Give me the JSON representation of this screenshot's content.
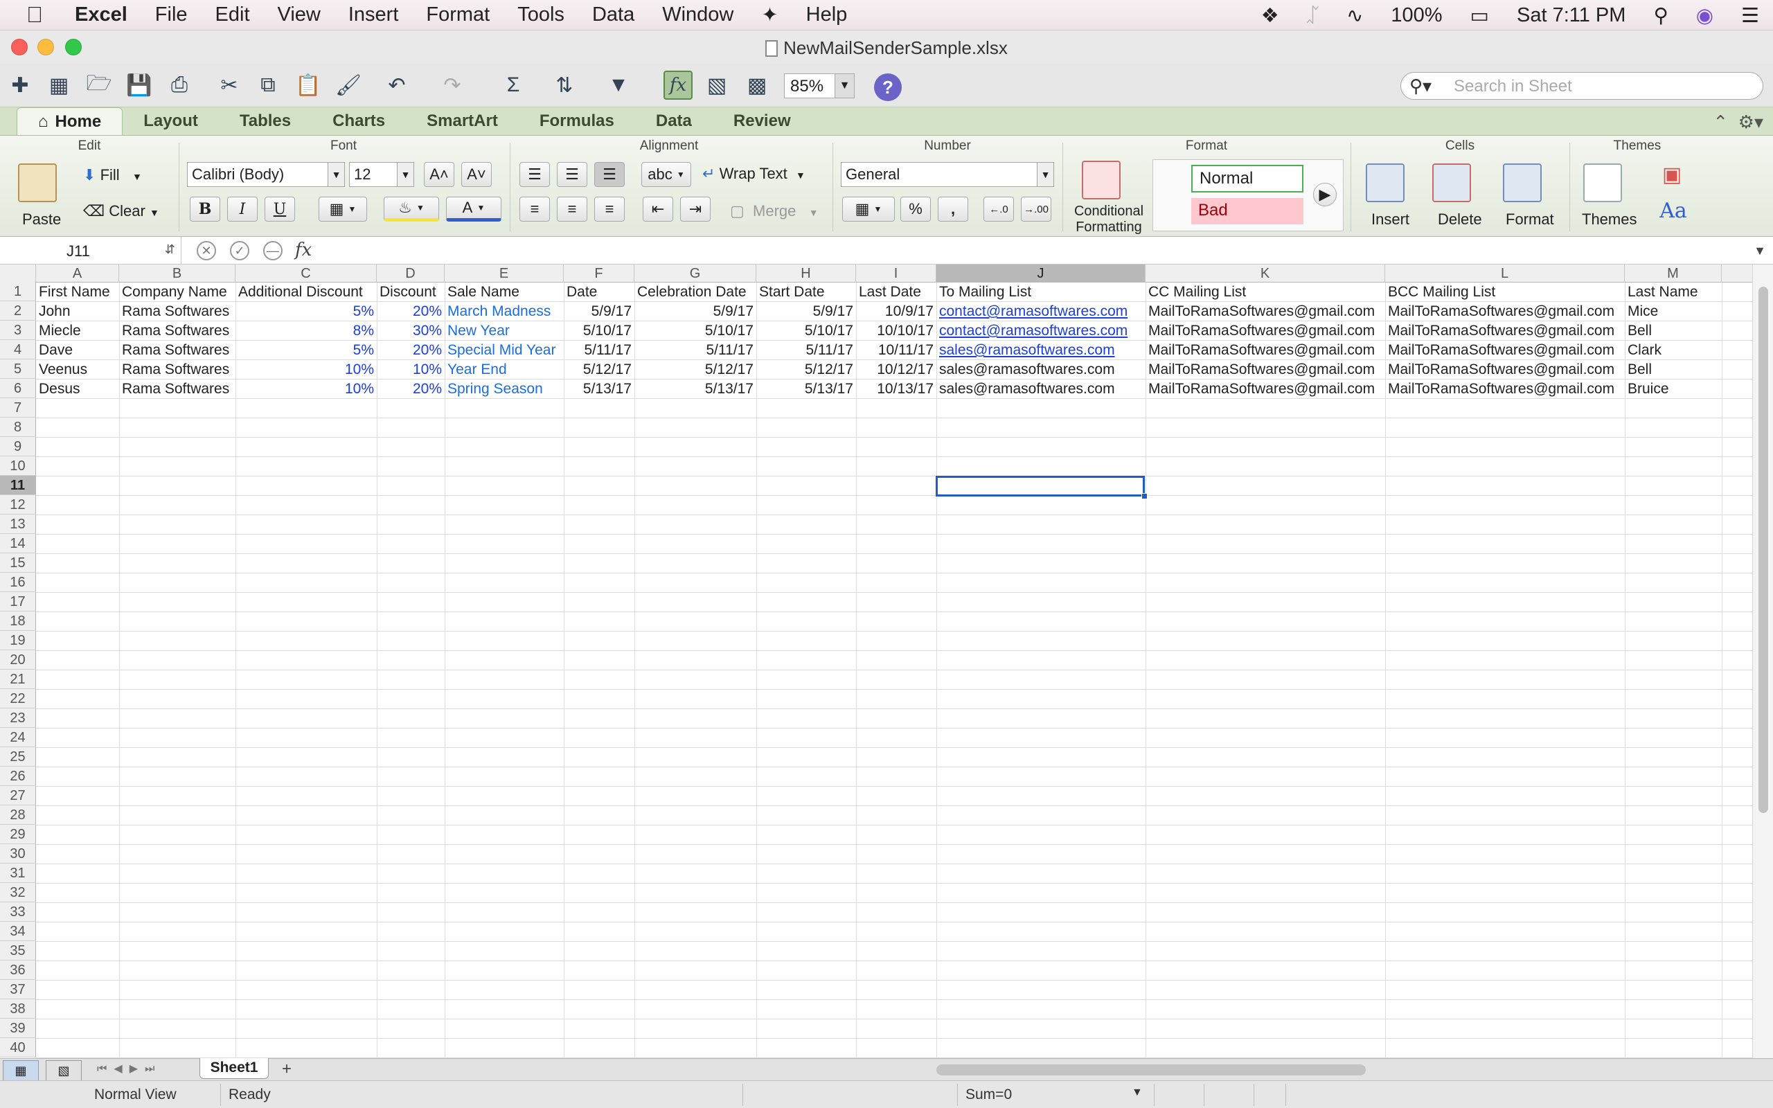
{
  "menubar": {
    "app": "Excel",
    "items": [
      "File",
      "Edit",
      "View",
      "Insert",
      "Format",
      "Tools",
      "Data",
      "Window",
      "Help"
    ],
    "battery": "100%",
    "clock": "Sat 7:11 PM"
  },
  "window": {
    "title": "NewMailSenderSample.xlsx"
  },
  "toolbar": {
    "zoom": "85%",
    "search_placeholder": "Search in Sheet"
  },
  "ribbon": {
    "tabs": [
      "Home",
      "Layout",
      "Tables",
      "Charts",
      "SmartArt",
      "Formulas",
      "Data",
      "Review"
    ],
    "groups": {
      "edit": "Edit",
      "font": "Font",
      "alignment": "Alignment",
      "number": "Number",
      "format": "Format",
      "cells": "Cells",
      "themes": "Themes"
    },
    "paste": "Paste",
    "fill": "Fill",
    "clear": "Clear",
    "font_name": "Calibri (Body)",
    "font_size": "12",
    "bold": "B",
    "italic": "I",
    "underline": "U",
    "wrap_text": "Wrap Text",
    "abc": "abc",
    "merge": "Merge",
    "number_format": "General",
    "percent": "%",
    "comma": ",",
    "conditional_formatting_1": "Conditional",
    "conditional_formatting_2": "Formatting",
    "style_normal": "Normal",
    "style_bad": "Bad",
    "insert": "Insert",
    "delete": "Delete",
    "format_btn": "Format",
    "themes": "Themes"
  },
  "formula_bar": {
    "name_box": "J11",
    "formula": ""
  },
  "sheet": {
    "columns": [
      "A",
      "B",
      "C",
      "D",
      "E",
      "F",
      "G",
      "H",
      "I",
      "J",
      "K",
      "L",
      "M"
    ],
    "selected_column": "J",
    "selected_row": 11,
    "rows": [
      [
        "First Name",
        "Company Name",
        "Additional Discount",
        "Discount",
        "Sale Name",
        "Date",
        "Celebration Date",
        "Start Date",
        "Last Date",
        "To Mailing List",
        "CC Mailing List",
        "BCC Mailing List",
        "Last Name"
      ],
      [
        "John",
        "Rama Softwares",
        "5%",
        "20%",
        "March Madness",
        "5/9/17",
        "5/9/17",
        "5/9/17",
        "10/9/17",
        "contact@ramasoftwares.com",
        "MailToRamaSoftwares@gmail.com",
        "MailToRamaSoftwares@gmail.com",
        "Mice"
      ],
      [
        "Miecle",
        "Rama Softwares",
        "8%",
        "30%",
        "New Year",
        "5/10/17",
        "5/10/17",
        "5/10/17",
        "10/10/17",
        "contact@ramasoftwares.com",
        "MailToRamaSoftwares@gmail.com",
        "MailToRamaSoftwares@gmail.com",
        "Bell"
      ],
      [
        "Dave",
        "Rama Softwares",
        "5%",
        "20%",
        "Special Mid Year",
        "5/11/17",
        "5/11/17",
        "5/11/17",
        "10/11/17",
        "sales@ramasoftwares.com",
        "MailToRamaSoftwares@gmail.com",
        "MailToRamaSoftwares@gmail.com",
        "Clark"
      ],
      [
        "Veenus",
        "Rama Softwares",
        "10%",
        "10%",
        "Year End",
        "5/12/17",
        "5/12/17",
        "5/12/17",
        "10/12/17",
        "sales@ramasoftwares.com",
        "MailToRamaSoftwares@gmail.com",
        "MailToRamaSoftwares@gmail.com",
        "Bell"
      ],
      [
        "Desus",
        "Rama Softwares",
        "10%",
        "20%",
        "Spring Season",
        "5/13/17",
        "5/13/17",
        "5/13/17",
        "10/13/17",
        "sales@ramasoftwares.com",
        "MailToRamaSoftwares@gmail.com",
        "MailToRamaSoftwares@gmail.com",
        "Bruice"
      ]
    ],
    "linked_cells": [
      "r1c9",
      "r2c9",
      "r3c9"
    ],
    "row_count": 40,
    "sheet_tabs": [
      "Sheet1"
    ]
  },
  "status": {
    "view": "Normal View",
    "state": "Ready",
    "sum": "Sum=0"
  }
}
